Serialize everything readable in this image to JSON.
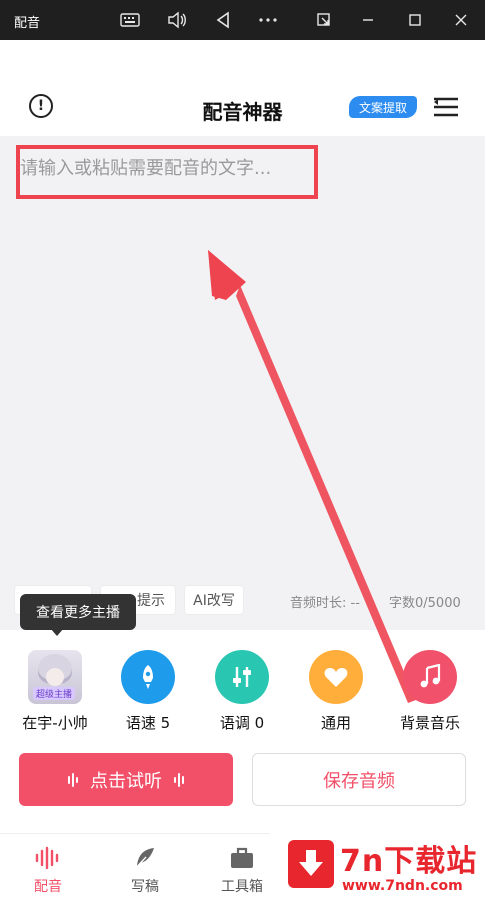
{
  "window": {
    "title": "配音",
    "controls": [
      "keyboard-icon",
      "volume-icon",
      "back-triangle-icon",
      "more-dots-icon",
      "restore-icon",
      "minimize-icon",
      "maximize-icon",
      "close-icon"
    ]
  },
  "header": {
    "title": "配音神器",
    "extract_label": "文案提取"
  },
  "editor": {
    "placeholder": "请输入或粘贴需要配音的文字..."
  },
  "chips": {
    "hint_label": "提示",
    "ai_label": "AI改写"
  },
  "stats": {
    "duration_label": "音频时长: --",
    "char_count_label": "字数0/5000"
  },
  "tooltip": "查看更多主播",
  "tools": [
    {
      "label": "在宇-小帅",
      "badge": "超级主播"
    },
    {
      "label": "语速 5",
      "color": "#1e9bea"
    },
    {
      "label": "语调 0",
      "color": "#29c6b2"
    },
    {
      "label": "通用",
      "color": "#ffae3b"
    },
    {
      "label": "背景音乐",
      "color": "#f2516b"
    }
  ],
  "actions": {
    "listen_label": "点击试听",
    "save_label": "保存音频"
  },
  "tabs": [
    {
      "label": "配音",
      "active": true
    },
    {
      "label": "写稿",
      "active": false
    },
    {
      "label": "工具箱",
      "active": false
    }
  ],
  "watermark": {
    "title": "7n下载站",
    "url": "www.7ndn.com"
  },
  "colors": {
    "accent": "#f25068",
    "highlight": "#ee4450",
    "badge_blue": "#2d8cf0"
  }
}
